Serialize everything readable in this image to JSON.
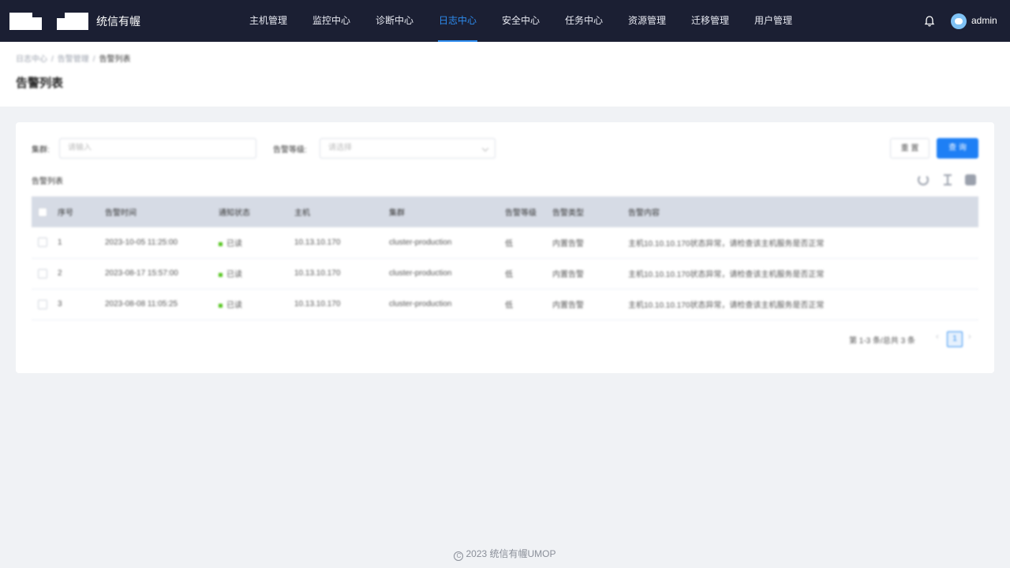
{
  "app": {
    "brand": "统信有幄",
    "user": "admin"
  },
  "nav": {
    "items": [
      {
        "label": "主机管理"
      },
      {
        "label": "监控中心"
      },
      {
        "label": "诊断中心"
      },
      {
        "label": "日志中心",
        "active": true
      },
      {
        "label": "安全中心"
      },
      {
        "label": "任务中心"
      },
      {
        "label": "资源管理"
      },
      {
        "label": "迁移管理"
      },
      {
        "label": "用户管理"
      }
    ]
  },
  "breadcrumb": {
    "level1": "日志中心",
    "level2": "告警管理",
    "current": "告警列表",
    "sep": "/"
  },
  "page": {
    "title": "告警列表"
  },
  "filters": {
    "cluster_label": "集群:",
    "cluster_placeholder": "请输入",
    "level_label": "告警等级:",
    "level_placeholder": "请选择",
    "reset": "重 置",
    "query": "查 询"
  },
  "table": {
    "title": "告警列表",
    "headers": [
      "序号",
      "告警时间",
      "通知状态",
      "主机",
      "集群",
      "告警等级",
      "告警类型",
      "告警内容"
    ],
    "rows": [
      {
        "no": "1",
        "time": "2023-10-05 11:25:00",
        "status": "已读",
        "host": "10.13.10.170",
        "cluster": "cluster-production",
        "level": "低",
        "type": "内置告警",
        "content": "主机10.10.10.170状态异常，请检查该主机服务是否正常"
      },
      {
        "no": "2",
        "time": "2023-08-17 15:57:00",
        "status": "已读",
        "host": "10.13.10.170",
        "cluster": "cluster-production",
        "level": "低",
        "type": "内置告警",
        "content": "主机10.10.10.170状态异常，请检查该主机服务是否正常"
      },
      {
        "no": "3",
        "time": "2023-08-08 11:05:25",
        "status": "已读",
        "host": "10.13.10.170",
        "cluster": "cluster-production",
        "level": "低",
        "type": "内置告警",
        "content": "主机10.10.10.170状态异常，请检查该主机服务是否正常"
      }
    ]
  },
  "pager": {
    "summary": "第 1-3 条/总共 3 条",
    "current": "1",
    "prev": "‹",
    "next": "›"
  },
  "footer": {
    "text": "2023 统信有幄UMOP",
    "copy_symbol": "C"
  },
  "colors": {
    "nav_bg": "#1b1f33",
    "accent": "#2d8cf0",
    "primary_button": "#1e7ff5",
    "status_read": "#52c41a"
  }
}
